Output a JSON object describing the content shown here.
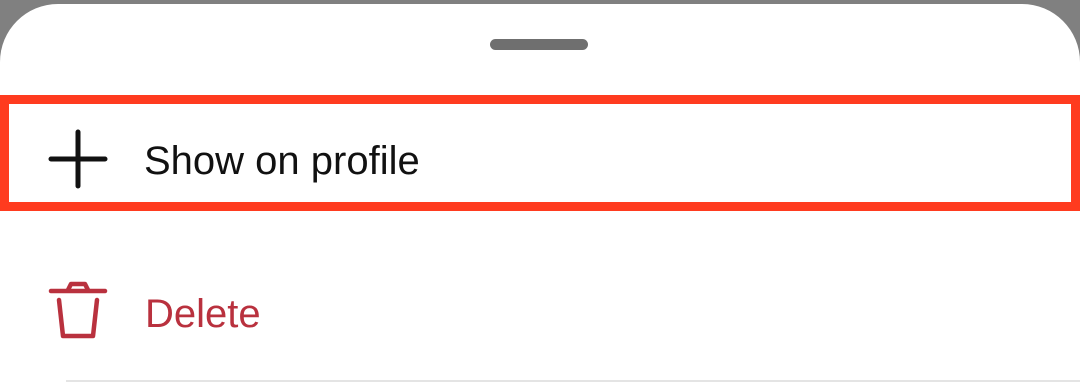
{
  "sheet": {
    "items": [
      {
        "label": "Show on profile",
        "icon": "plus-icon",
        "highlight_color": "#ff3b1f"
      },
      {
        "label": "Delete",
        "icon": "trash-icon",
        "text_color": "#b9313e"
      }
    ]
  }
}
